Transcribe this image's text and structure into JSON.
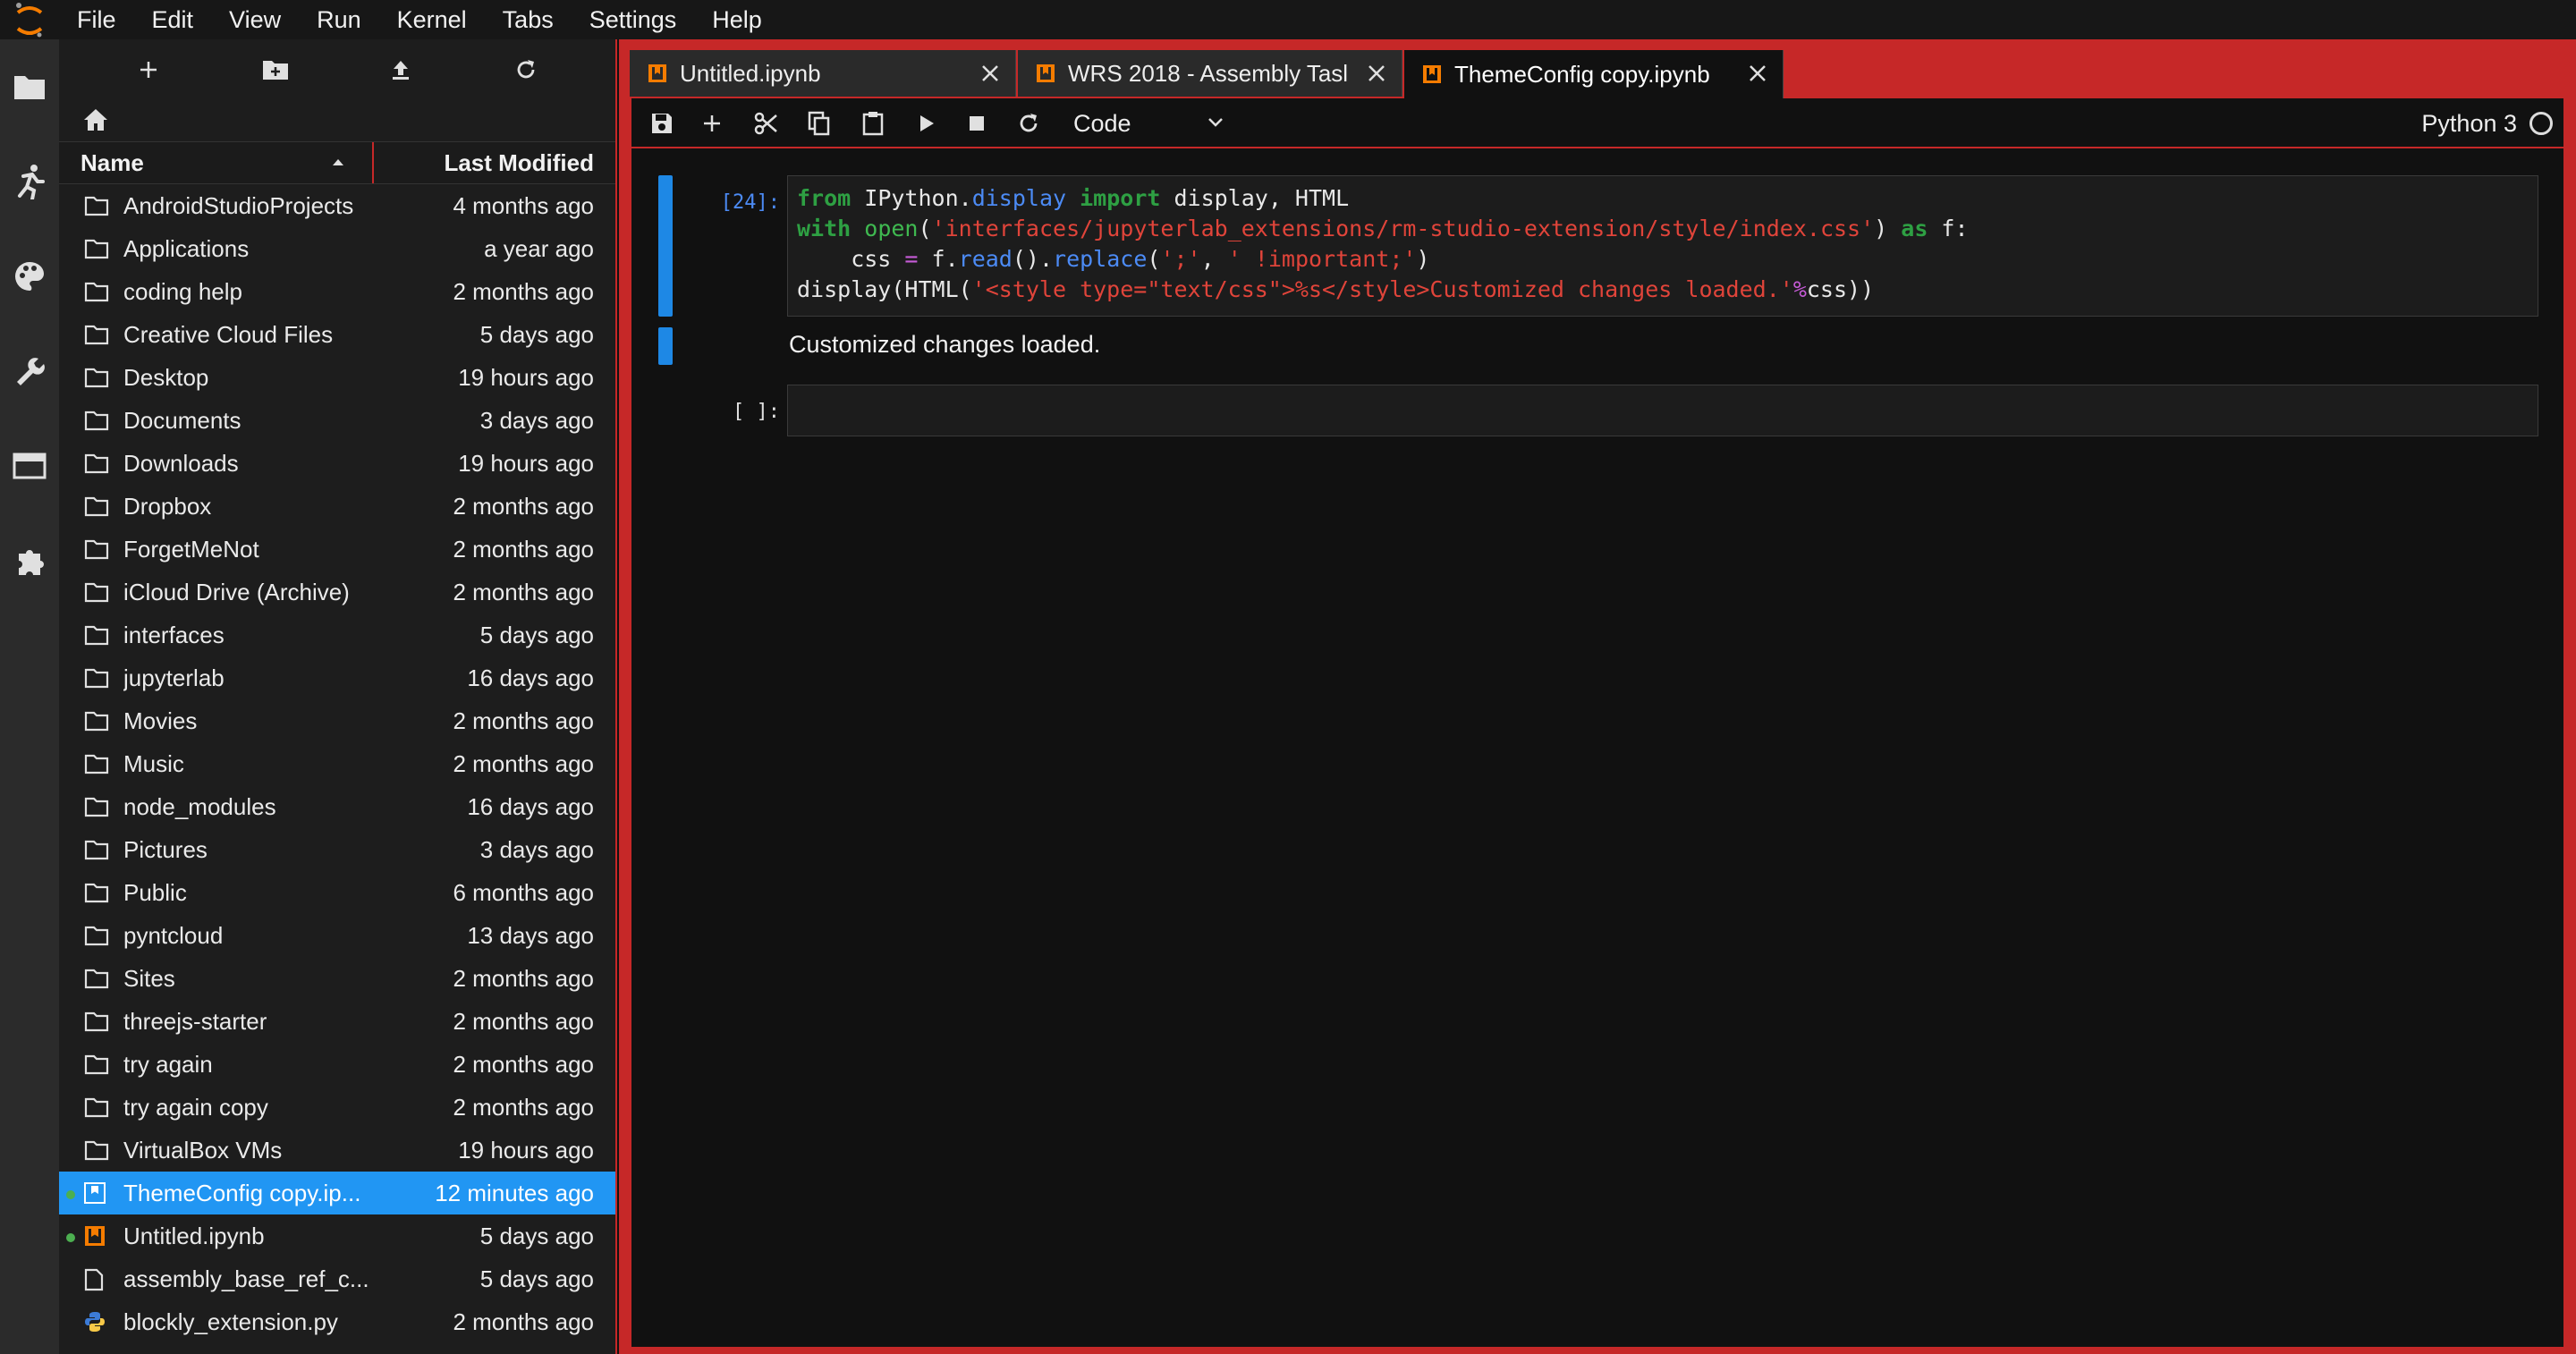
{
  "menu": [
    "File",
    "Edit",
    "View",
    "Run",
    "Kernel",
    "Tabs",
    "Settings",
    "Help"
  ],
  "colors": {
    "accent": "#c62828",
    "selection": "#2196f3",
    "cell_active": "#1e88e5",
    "running_dot": "#4caf50",
    "notebook_icon": "#f57c00"
  },
  "activity_icons": [
    "folder-icon",
    "running-icon",
    "palette-icon",
    "wrench-icon",
    "tabs-icon",
    "extension-icon"
  ],
  "filebrowser": {
    "toolbar_icons": [
      "new-launcher-icon",
      "new-folder-icon",
      "upload-icon",
      "refresh-icon"
    ],
    "columns": {
      "name": "Name",
      "modified": "Last Modified"
    },
    "items": [
      {
        "name": "AndroidStudioProjects",
        "modified": "4 months ago",
        "type": "folder"
      },
      {
        "name": "Applications",
        "modified": "a year ago",
        "type": "folder"
      },
      {
        "name": "coding help",
        "modified": "2 months ago",
        "type": "folder"
      },
      {
        "name": "Creative Cloud Files",
        "modified": "5 days ago",
        "type": "folder"
      },
      {
        "name": "Desktop",
        "modified": "19 hours ago",
        "type": "folder"
      },
      {
        "name": "Documents",
        "modified": "3 days ago",
        "type": "folder"
      },
      {
        "name": "Downloads",
        "modified": "19 hours ago",
        "type": "folder"
      },
      {
        "name": "Dropbox",
        "modified": "2 months ago",
        "type": "folder"
      },
      {
        "name": "ForgetMeNot",
        "modified": "2 months ago",
        "type": "folder"
      },
      {
        "name": "iCloud Drive (Archive)",
        "modified": "2 months ago",
        "type": "folder"
      },
      {
        "name": "interfaces",
        "modified": "5 days ago",
        "type": "folder"
      },
      {
        "name": "jupyterlab",
        "modified": "16 days ago",
        "type": "folder"
      },
      {
        "name": "Movies",
        "modified": "2 months ago",
        "type": "folder"
      },
      {
        "name": "Music",
        "modified": "2 months ago",
        "type": "folder"
      },
      {
        "name": "node_modules",
        "modified": "16 days ago",
        "type": "folder"
      },
      {
        "name": "Pictures",
        "modified": "3 days ago",
        "type": "folder"
      },
      {
        "name": "Public",
        "modified": "6 months ago",
        "type": "folder"
      },
      {
        "name": "pyntcloud",
        "modified": "13 days ago",
        "type": "folder"
      },
      {
        "name": "Sites",
        "modified": "2 months ago",
        "type": "folder"
      },
      {
        "name": "threejs-starter",
        "modified": "2 months ago",
        "type": "folder"
      },
      {
        "name": "try again",
        "modified": "2 months ago",
        "type": "folder"
      },
      {
        "name": "try again copy",
        "modified": "2 months ago",
        "type": "folder"
      },
      {
        "name": "VirtualBox VMs",
        "modified": "19 hours ago",
        "type": "folder"
      },
      {
        "name": "ThemeConfig copy.ip...",
        "modified": "12 minutes ago",
        "type": "notebook",
        "running": true,
        "selected": true
      },
      {
        "name": "Untitled.ipynb",
        "modified": "5 days ago",
        "type": "notebook",
        "running": true
      },
      {
        "name": "assembly_base_ref_c...",
        "modified": "5 days ago",
        "type": "file"
      },
      {
        "name": "blockly_extension.py",
        "modified": "2 months ago",
        "type": "python"
      }
    ]
  },
  "tabs": [
    {
      "label": "Untitled.ipynb",
      "active": false
    },
    {
      "label": "WRS 2018 - Assembly Tasl",
      "active": false
    },
    {
      "label": "ThemeConfig copy.ipynb",
      "active": true
    }
  ],
  "notebook": {
    "toolbar_icons": [
      "save-icon",
      "add-cell-icon",
      "cut-icon",
      "copy-icon",
      "paste-icon",
      "run-icon",
      "stop-icon",
      "restart-icon"
    ],
    "cell_type": "Code",
    "kernel": "Python 3",
    "cells": [
      {
        "prompt": "[24]:",
        "output": "Customized changes loaded."
      },
      {
        "prompt": "[ ]:"
      }
    ]
  }
}
